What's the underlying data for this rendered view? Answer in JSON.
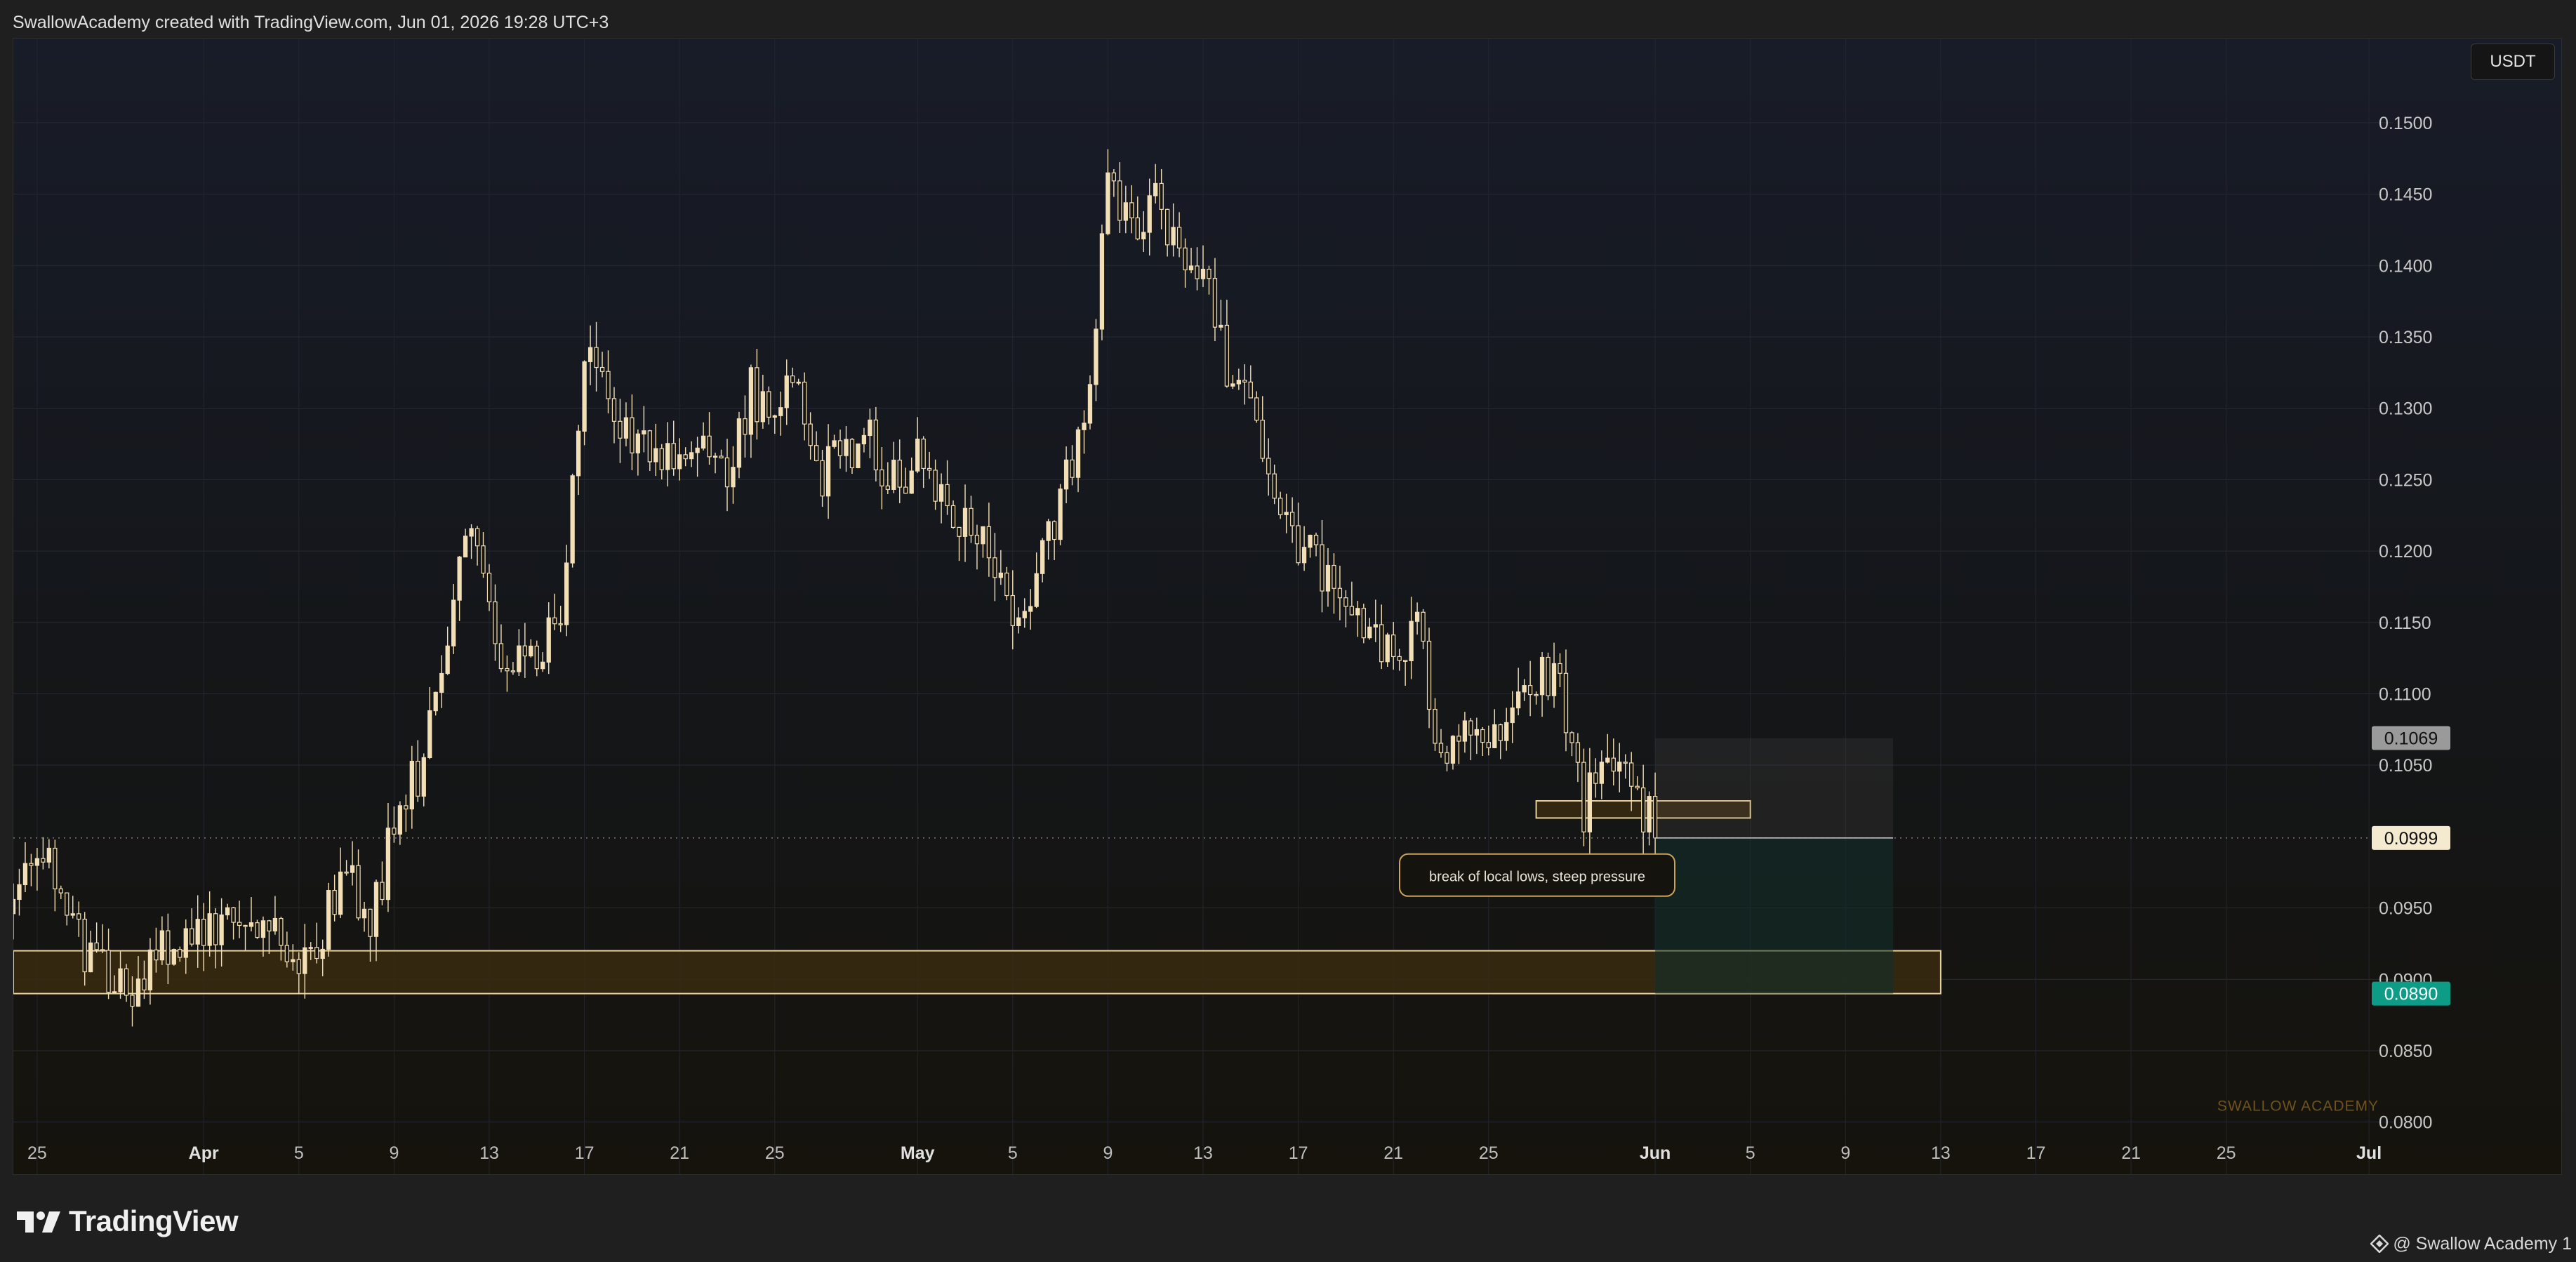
{
  "header": {
    "text": "SwallowAcademy created with TradingView.com, Jun 01, 2026 19:28 UTC+3"
  },
  "currency_label": "USDT",
  "watermark": "SWALLOW ACADEMY",
  "annotation": "break of local lows, steep pressure",
  "footer": {
    "brand": "TradingView",
    "user": "@ Swallow Academy 1"
  },
  "colors": {
    "candle": "#f3dfb6",
    "zone_fill": "#3a2a10",
    "zone_border": "#e8d19a",
    "target_fill": "#10302b",
    "current_label_bg": "#f4ead0",
    "target_label_bg": "#0d9c86",
    "stop_label_bg": "#9a9a9a"
  },
  "chart_data": {
    "type": "candlestick",
    "y_axis": {
      "ticks": [
        0.15,
        0.145,
        0.14,
        0.135,
        0.13,
        0.125,
        0.12,
        0.115,
        0.11,
        0.105,
        0.095,
        0.09,
        0.085,
        0.08
      ],
      "tick_labels": [
        "0.1500",
        "0.1450",
        "0.1400",
        "0.1350",
        "0.1300",
        "0.1250",
        "0.1200",
        "0.1150",
        "0.1100",
        "0.1050",
        "0.0950",
        "0.0900",
        "0.0850",
        "0.0800"
      ],
      "range": [
        0.079,
        0.1555
      ]
    },
    "x_axis": {
      "range": [
        "2026-03-24",
        "2026-07-02"
      ],
      "ticks": [
        {
          "date": "2026-03-25",
          "label": "25"
        },
        {
          "date": "2026-04-01",
          "label": "Apr"
        },
        {
          "date": "2026-04-05",
          "label": "5"
        },
        {
          "date": "2026-04-09",
          "label": "9"
        },
        {
          "date": "2026-04-13",
          "label": "13"
        },
        {
          "date": "2026-04-17",
          "label": "17"
        },
        {
          "date": "2026-04-21",
          "label": "21"
        },
        {
          "date": "2026-04-25",
          "label": "25"
        },
        {
          "date": "2026-05-01",
          "label": "May"
        },
        {
          "date": "2026-05-05",
          "label": "5"
        },
        {
          "date": "2026-05-09",
          "label": "9"
        },
        {
          "date": "2026-05-13",
          "label": "13"
        },
        {
          "date": "2026-05-17",
          "label": "17"
        },
        {
          "date": "2026-05-21",
          "label": "21"
        },
        {
          "date": "2026-05-25",
          "label": "25"
        },
        {
          "date": "2026-06-01",
          "label": "Jun"
        },
        {
          "date": "2026-06-05",
          "label": "5"
        },
        {
          "date": "2026-06-09",
          "label": "9"
        },
        {
          "date": "2026-06-13",
          "label": "13"
        },
        {
          "date": "2026-06-17",
          "label": "17"
        },
        {
          "date": "2026-06-21",
          "label": "21"
        },
        {
          "date": "2026-06-25",
          "label": "25"
        },
        {
          "date": "2026-07-01",
          "label": "Jul"
        }
      ]
    },
    "price_path": [
      [
        "2026-03-24",
        0.097
      ],
      [
        "2026-03-25",
        0.099
      ],
      [
        "2026-03-26",
        0.0955
      ],
      [
        "2026-03-27",
        0.0925
      ],
      [
        "2026-03-28",
        0.09
      ],
      [
        "2026-03-29",
        0.0895
      ],
      [
        "2026-03-30",
        0.0915
      ],
      [
        "2026-03-31",
        0.0925
      ],
      [
        "2026-04-01",
        0.093
      ],
      [
        "2026-04-02",
        0.095
      ],
      [
        "2026-04-03",
        0.092
      ],
      [
        "2026-04-04",
        0.0935
      ],
      [
        "2026-04-05",
        0.0915
      ],
      [
        "2026-04-06",
        0.0935
      ],
      [
        "2026-04-07",
        0.0975
      ],
      [
        "2026-04-08",
        0.0935
      ],
      [
        "2026-04-09",
        0.1015
      ],
      [
        "2026-04-10",
        0.104
      ],
      [
        "2026-04-11",
        0.11
      ],
      [
        "2026-04-12",
        0.121
      ],
      [
        "2026-04-13",
        0.116
      ],
      [
        "2026-04-14",
        0.1115
      ],
      [
        "2026-04-15",
        0.113
      ],
      [
        "2026-04-16",
        0.116
      ],
      [
        "2026-04-17",
        0.133
      ],
      [
        "2026-04-18",
        0.132
      ],
      [
        "2026-04-19",
        0.126
      ],
      [
        "2026-04-20",
        0.128
      ],
      [
        "2026-04-21",
        0.126
      ],
      [
        "2026-04-22",
        0.129
      ],
      [
        "2026-04-23",
        0.125
      ],
      [
        "2026-04-24",
        0.131
      ],
      [
        "2026-04-25",
        0.13
      ],
      [
        "2026-04-26",
        0.131
      ],
      [
        "2026-04-27",
        0.125
      ],
      [
        "2026-04-28",
        0.1265
      ],
      [
        "2026-04-29",
        0.128
      ],
      [
        "2026-04-30",
        0.125
      ],
      [
        "2026-05-01",
        0.1265
      ],
      [
        "2026-05-02",
        0.123
      ],
      [
        "2026-05-03",
        0.122
      ],
      [
        "2026-05-04",
        0.119
      ],
      [
        "2026-05-05",
        0.115
      ],
      [
        "2026-05-06",
        0.119
      ],
      [
        "2026-05-07",
        0.124
      ],
      [
        "2026-05-08",
        0.128
      ],
      [
        "2026-05-09",
        0.1465
      ],
      [
        "2026-05-10",
        0.142
      ],
      [
        "2026-05-11",
        0.1445
      ],
      [
        "2026-05-12",
        0.14
      ],
      [
        "2026-05-13",
        0.1405
      ],
      [
        "2026-05-14",
        0.132
      ],
      [
        "2026-05-15",
        0.132
      ],
      [
        "2026-05-16",
        0.124
      ],
      [
        "2026-05-17",
        0.121
      ],
      [
        "2026-05-18",
        0.118
      ],
      [
        "2026-05-19",
        0.116
      ],
      [
        "2026-05-20",
        0.115
      ],
      [
        "2026-05-21",
        0.112
      ],
      [
        "2026-05-22",
        0.114
      ],
      [
        "2026-05-23",
        0.106
      ],
      [
        "2026-05-24",
        0.109
      ],
      [
        "2026-05-25",
        0.107
      ],
      [
        "2026-05-26",
        0.109
      ],
      [
        "2026-05-27",
        0.111
      ],
      [
        "2026-05-28",
        0.11
      ],
      [
        "2026-05-29",
        0.102
      ],
      [
        "2026-05-30",
        0.104
      ],
      [
        "2026-05-31",
        0.104
      ],
      [
        "2026-06-01",
        0.0999
      ]
    ],
    "last_price": 0.0999,
    "price_labels": [
      {
        "role": "stop",
        "value": 0.1069,
        "text": "0.1069"
      },
      {
        "role": "current",
        "value": 0.0999,
        "text": "0.0999"
      },
      {
        "role": "target",
        "value": 0.089,
        "text": "0.0890"
      }
    ],
    "zones": [
      {
        "name": "support-zone",
        "from_date": "2026-03-24",
        "to_date": "2026-06-13",
        "low": 0.089,
        "high": 0.092
      },
      {
        "name": "breakdown-zone",
        "from_date": "2026-05-27",
        "to_date": "2026-06-05",
        "low": 0.1013,
        "high": 0.1025
      }
    ],
    "position": {
      "type": "short",
      "from_date": "2026-06-01",
      "to_date": "2026-06-11",
      "entry": 0.0999,
      "stop": 0.1069,
      "target": 0.089
    }
  }
}
